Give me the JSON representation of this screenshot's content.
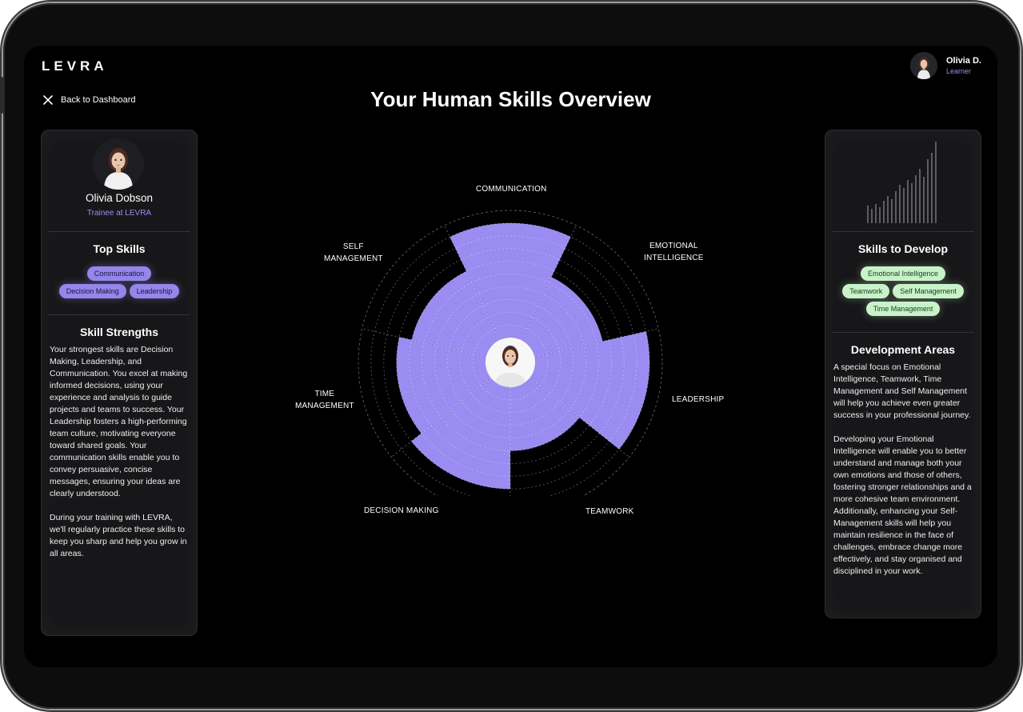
{
  "app": {
    "logo": "LEVRA"
  },
  "user": {
    "name": "Olivia D.",
    "role": "Learner"
  },
  "nav": {
    "back_label": "Back to Dashboard"
  },
  "page": {
    "title": "Your Human Skills Overview"
  },
  "profile": {
    "name": "Olivia Dobson",
    "role": "Trainee at LEVRA"
  },
  "top_skills": {
    "title": "Top Skills",
    "chips": [
      "Communication",
      "Decision Making",
      "Leadership"
    ]
  },
  "strengths": {
    "title": "Skill Strengths",
    "paragraphs": [
      "Your strongest skills are Decision Making, Leadership, and Communication. You excel at making informed decisions, using your experience and analysis to guide projects and teams to success. Your Leadership fosters a high-performing team culture, motivating everyone toward shared goals. Your communication skills enable you to convey persuasive, concise messages, ensuring your ideas are clearly understood.",
      "During your training with LEVRA, we'll regularly practice these skills to keep you sharp and help you grow in all areas."
    ]
  },
  "develop": {
    "title": "Skills to Develop",
    "chips": [
      "Emotional Intelligence",
      "Teamwork",
      "Self Management",
      "Time Management"
    ]
  },
  "dev_areas": {
    "title": "Development Areas",
    "paragraphs": [
      "A special focus on Emotional Intelligence, Teamwork, Time Management and Self Management will help you achieve even greater success in your professional journey.",
      "Developing your Emotional Intelligence will enable you to better understand and manage both your own emotions and those of others, fostering stronger relationships and a more cohesive team environment. Additionally, enhancing your Self-Management skills will help you maintain resilience in the face of challenges, embrace change more effectively, and stay organised and disciplined in your work."
    ]
  },
  "chart_data": {
    "type": "radial-bar",
    "title": "",
    "max": 10,
    "categories": [
      "COMMUNICATION",
      "EMOTIONAL INTELLIGENCE",
      "LEADERSHIP",
      "TEAMWORK",
      "DECISION MAKING",
      "TIME MANAGEMENT",
      "SELF MANAGEMENT"
    ],
    "labels": [
      [
        "COMMUNICATION"
      ],
      [
        "EMOTIONAL",
        "INTELLIGENCE"
      ],
      [
        "LEADERSHIP"
      ],
      [
        "TEAMWORK"
      ],
      [
        "DECISION MAKING"
      ],
      [
        "TIME",
        "MANAGEMENT"
      ],
      [
        "SELF",
        "MANAGEMENT"
      ]
    ],
    "series": [
      {
        "values": [
          9,
          5.5,
          9,
          5,
          8,
          7,
          6
        ]
      }
    ],
    "fill_color": "#9a8cf0",
    "grid_rings": 10
  }
}
